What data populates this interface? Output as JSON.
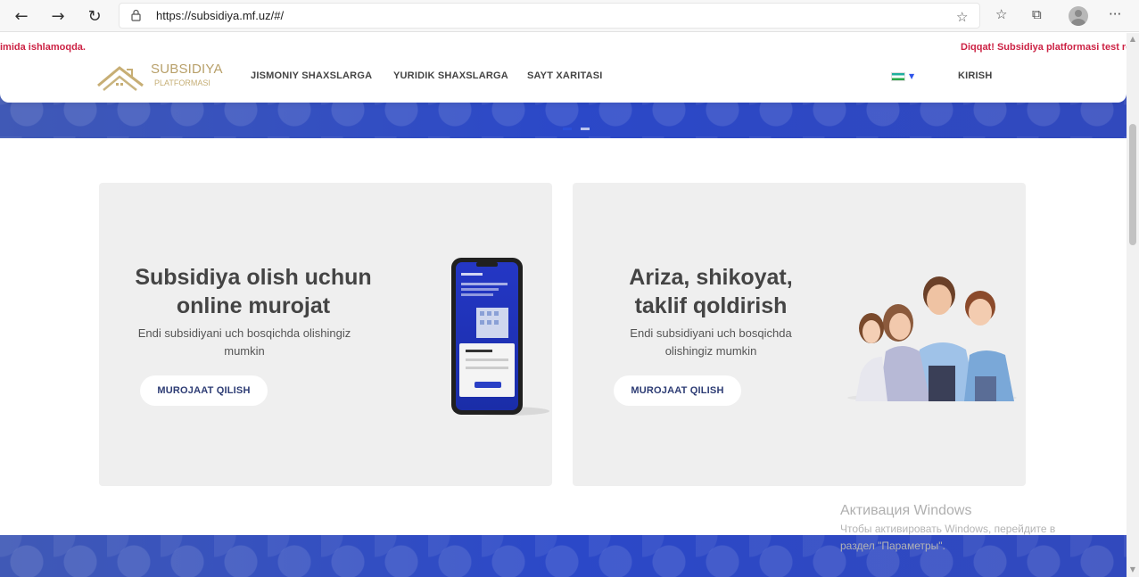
{
  "browser": {
    "url": "https://subsidiya.mf.uz/#/"
  },
  "ticker": {
    "left": "imida ishlamoqda.",
    "right": "Diqqat! Subsidiya platformasi test rejimida ishlamoqda."
  },
  "logo": {
    "title": "SUBSIDIYA",
    "subtitle": "PLATFORMASI"
  },
  "nav": {
    "items": [
      "JISMONIY SHAXSLARGA",
      "YURIDIK SHAXSLARGA",
      "SAYT XARITASI"
    ],
    "login": "KIRISH",
    "language_flag": "flag-uzbekistan-icon"
  },
  "cards": [
    {
      "title_line1": "Subsidiya olish uchun",
      "title_line2": "online murojat",
      "text_line1": "Endi subsidiyani uch bosqichda olishingiz",
      "text_line2": "mumkin",
      "button": "MUROJAAT QILISH"
    },
    {
      "title_line1": "Ariza, shikoyat,",
      "title_line2": "taklif qoldirish",
      "text_line1": "Endi subsidiyani uch bosqichda",
      "text_line2": "olishingiz mumkin",
      "button": "MUROJAAT QILISH"
    }
  ],
  "windows_watermark": {
    "title": "Активация Windows",
    "line1": "Чтобы активировать Windows, перейдите в",
    "line2": "раздел \"Параметры\"."
  },
  "colors": {
    "brand_blue": "#2c44b6",
    "ticker_red": "#cc2244",
    "logo_gold": "#b8a06a",
    "card_bg": "#efefef",
    "button_text": "#2d3c74"
  }
}
